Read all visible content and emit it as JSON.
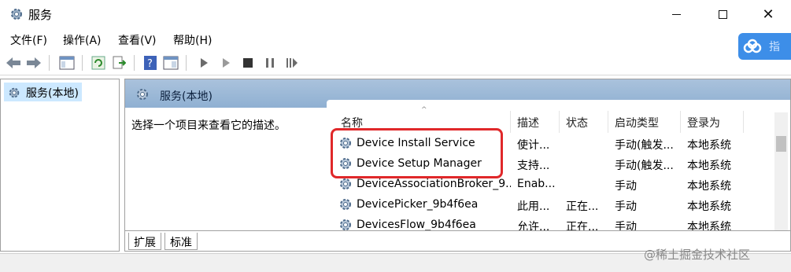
{
  "window": {
    "title": "服务"
  },
  "menu": {
    "file": "文件(F)",
    "action": "操作(A)",
    "view": "查看(V)",
    "help": "帮助(H)"
  },
  "side_widget": {
    "text": "指"
  },
  "tree": {
    "root_label": "服务(本地)"
  },
  "main": {
    "header_title": "服务(本地)",
    "description_prompt": "选择一个项目来查看它的描述。"
  },
  "columns": {
    "name": "名称",
    "description": "描述",
    "status": "状态",
    "startup_type": "启动类型",
    "log_on_as": "登录为"
  },
  "services": [
    {
      "name": "Device Install Service",
      "description": "使计...",
      "status": "",
      "startup_type": "手动(触发...",
      "log_on_as": "本地系统"
    },
    {
      "name": "Device Setup Manager",
      "description": "支持...",
      "status": "",
      "startup_type": "手动(触发...",
      "log_on_as": "本地系统"
    },
    {
      "name": "DeviceAssociationBroker_9...",
      "description": "Enab...",
      "status": "",
      "startup_type": "手动",
      "log_on_as": "本地系统"
    },
    {
      "name": "DevicePicker_9b4f6ea",
      "description": "此用...",
      "status": "正在...",
      "startup_type": "手动",
      "log_on_as": "本地系统"
    },
    {
      "name": "DevicesFlow_9b4f6ea",
      "description": "允许...",
      "status": "正在...",
      "startup_type": "手动",
      "log_on_as": "本地系统"
    }
  ],
  "tabs": {
    "extended": "扩展",
    "standard": "标准"
  },
  "watermark": "@稀土掘金技术社区",
  "colors": {
    "highlight": "#e0282a",
    "header_bg": "#9db9d8",
    "widget": "#3d8ee8"
  }
}
